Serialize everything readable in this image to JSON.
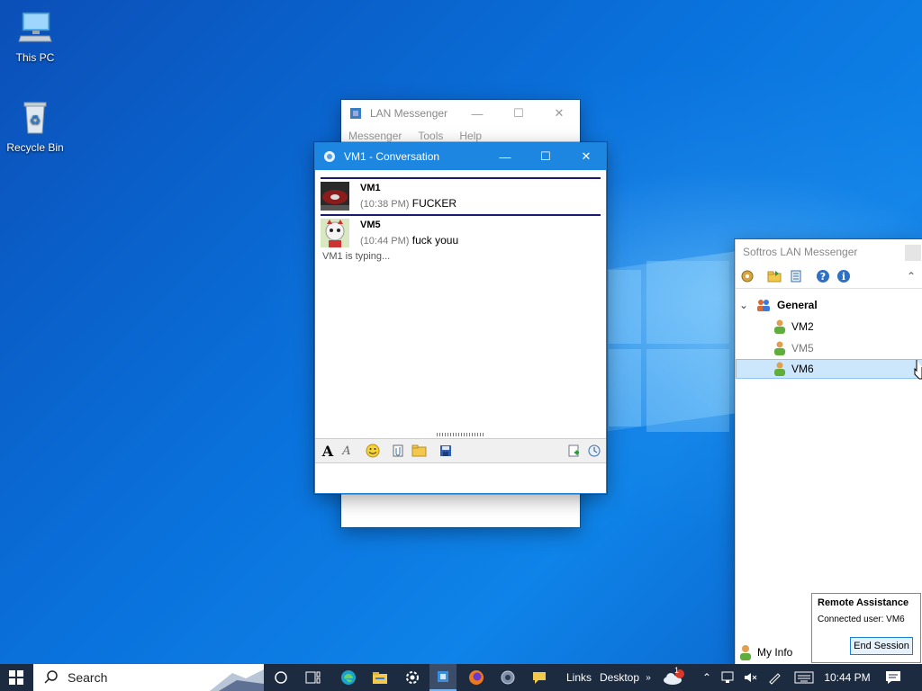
{
  "desktop": {
    "icons": [
      {
        "label": "This PC",
        "icon": "computer-icon"
      },
      {
        "label": "Recycle Bin",
        "icon": "recycle-bin-icon"
      }
    ],
    "accent": "#0a72dc"
  },
  "bg_window": {
    "title": "LAN Messenger",
    "menu": [
      "Messenger",
      "Tools",
      "Help"
    ]
  },
  "conversation": {
    "title": "VM1 - Conversation",
    "accent": "#1c86e0",
    "messages": [
      {
        "sender": "VM1",
        "time": "(10:38 PM)",
        "text": "FUCKER"
      },
      {
        "sender": "VM5",
        "time": "(10:44 PM)",
        "text": "fuck youu"
      }
    ],
    "typing": "VM1 is typing...",
    "toolbar_icons": [
      "font-icon",
      "font-style-icon",
      "smiley-icon",
      "attach-file-icon",
      "send-folder-icon",
      "save-icon",
      "clear-icon",
      "history-icon"
    ]
  },
  "softros": {
    "title": "Softros LAN Messenger",
    "group": "General",
    "users": [
      "VM2",
      "VM5",
      "VM6"
    ],
    "selected_user": "VM6",
    "my_info": "My Info"
  },
  "remote_assistance": {
    "title": "Remote Assistance",
    "connected": "Connected user: VM6",
    "end_button": "End Session"
  },
  "taskbar": {
    "search_placeholder": "Search",
    "links": "Links",
    "desktop": "Desktop",
    "time": "10:44 PM",
    "weather_badge": "1"
  }
}
